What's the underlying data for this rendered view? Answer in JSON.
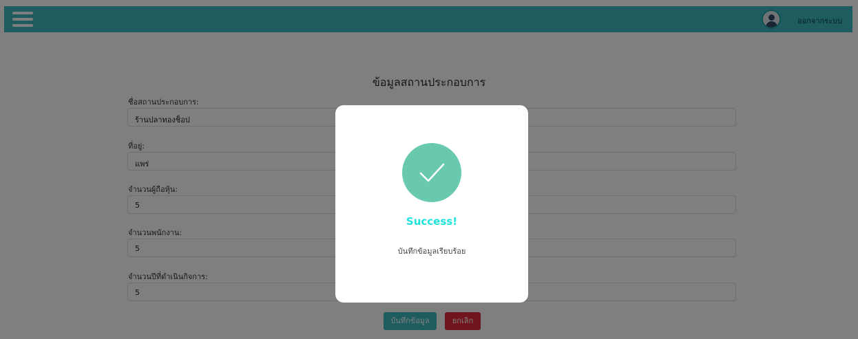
{
  "header": {
    "menu_icon": "hamburger-icon",
    "avatar_icon": "user-avatar-icon",
    "logout_label": "ออกจากระบบ",
    "bg_color": "#3bb8bf"
  },
  "form": {
    "title": "ข้อมูลสถานประกอบการ",
    "fields": [
      {
        "label": "ชื่อสถานประกอบการ:",
        "value": "ร้านปลาทองช็อป"
      },
      {
        "label": "ที่อยู่:",
        "value": "แพร่"
      },
      {
        "label": "จำนวนผู้ถือหุ้น:",
        "value": "5"
      },
      {
        "label": "จำนวนพนักงาน:",
        "value": "5"
      },
      {
        "label": "จำนวนปีที่ดำเนินกิจการ:",
        "value": "5"
      }
    ],
    "save_label": "บันทึกข้อมูล",
    "cancel_label": "ยกเลิก"
  },
  "modal": {
    "icon": "check-icon",
    "title": "Success!",
    "message": "บันทึกข้อมูลเรียบร้อย",
    "accent_color": "#69c9ae"
  }
}
